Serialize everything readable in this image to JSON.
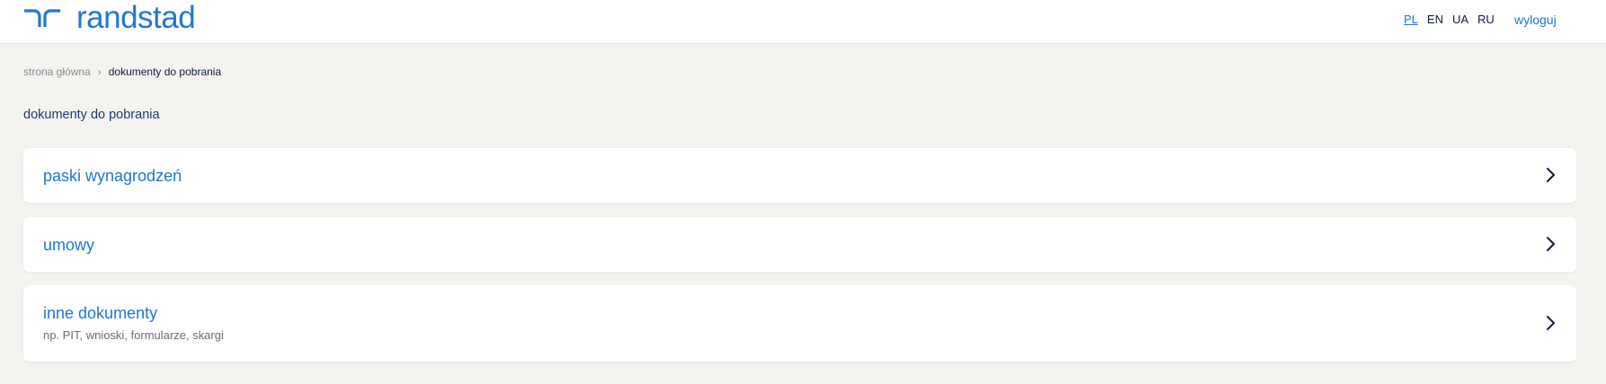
{
  "header": {
    "logo_text": "randstad",
    "languages": [
      {
        "code": "PL",
        "active": true
      },
      {
        "code": "EN",
        "active": false
      },
      {
        "code": "UA",
        "active": false
      },
      {
        "code": "RU",
        "active": false
      }
    ],
    "logout_label": "wyloguj"
  },
  "breadcrumb": {
    "home_label": "strona główna",
    "separator": "›",
    "current_label": "dokumenty do pobrania"
  },
  "page": {
    "title": "dokumenty do pobrania"
  },
  "cards": [
    {
      "title": "paski wynagrodzeń",
      "subtitle": ""
    },
    {
      "title": "umowy",
      "subtitle": ""
    },
    {
      "title": "inne dokumenty",
      "subtitle": "np. PIT, wnioski, formularze, skargi"
    }
  ],
  "colors": {
    "brand_blue": "#2175d9",
    "navy": "#0f1941",
    "background": "#f4f3ef"
  },
  "icons": {
    "logo_mark": "randstad-logo-mark-icon",
    "card_arrow": "chevron-right-icon"
  }
}
